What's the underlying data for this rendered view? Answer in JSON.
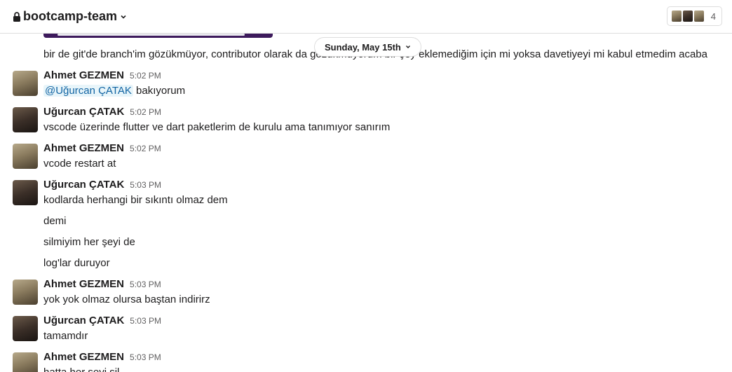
{
  "header": {
    "channel_name": "bootcamp-team",
    "member_count": "4",
    "icons": [
      "lock-icon",
      "chevron-down-icon"
    ]
  },
  "date_divider": {
    "label": "Sunday, May 15th"
  },
  "messages": {
    "m0": {
      "text": "bir de git'de branch'im gözükmüyor, contributor olarak da gözükmüyorum bir şey eklemediğim için mi yoksa davetiyeyi mi kabul etmedim acaba"
    },
    "m1": {
      "sender": "Ahmet GEZMEN",
      "time": "5:02 PM",
      "mention": "@Uğurcan ÇATAK",
      "text": "bakıyorum"
    },
    "m2": {
      "sender": "Uğurcan ÇATAK",
      "time": "5:02 PM",
      "text": "vscode üzerinde flutter ve dart paketlerim de kurulu ama tanımıyor sanırım"
    },
    "m3": {
      "sender": "Ahmet GEZMEN",
      "time": "5:02 PM",
      "text": "vcode restart at"
    },
    "m4": {
      "sender": "Uğurcan ÇATAK",
      "time": "5:03 PM",
      "text": "kodlarda herhangi bir sıkıntı olmaz dem"
    },
    "m5": {
      "text": "demi"
    },
    "m6": {
      "text": "silmiyim her şeyi de"
    },
    "m7": {
      "text": "log'lar duruyor"
    },
    "m8": {
      "sender": "Ahmet GEZMEN",
      "time": "5:03 PM",
      "text": "yok yok olmaz olursa baştan indirirz"
    },
    "m9": {
      "sender": "Uğurcan ÇATAK",
      "time": "5:03 PM",
      "text": "tamamdır"
    },
    "m10": {
      "sender": "Ahmet GEZMEN",
      "time": "5:03 PM",
      "text": "hatta her şeyi sil"
    }
  }
}
